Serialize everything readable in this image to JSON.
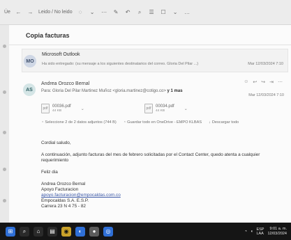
{
  "toolbar": {
    "left_items": [
      "Úe",
      "←",
      "→",
      "Leido / No leido",
      "◌",
      "⌄",
      "⋯",
      "✎",
      "↶",
      "⌕",
      "☰",
      "☐",
      "⌄",
      "…"
    ],
    "colors": {
      "bg": "#ececec"
    }
  },
  "mail": {
    "subject": "Copia facturas",
    "message1": {
      "avatar": "MO",
      "sender": "Microsoft Outlook",
      "preview": "Ha sido entregado: (su mensaje a los siguientes destinatarios del correo. Gloria Del Pilar ...)",
      "date": "Mar 12/03/2024 7:10"
    },
    "message2": {
      "avatar": "AS",
      "sender": "Andrea Orozco Bernal",
      "to_prefix": "Para:",
      "to_name": "Gloria Del Pilar Martinez Muñoz <gloria.martinez@cotigo.co>",
      "to_suffix": "y 1 mas",
      "date": "Mar 12/03/2024 7:10",
      "tools": [
        "☺",
        "↩",
        "↪",
        "⇥",
        "⋯"
      ],
      "attachments": [
        {
          "name": "00036.pdf",
          "size": "44 KB"
        },
        {
          "name": "00034.pdf",
          "size": "44 KB"
        }
      ],
      "attachment_actions": [
        "Seleccione 2 de 2 datos adjuntos (744 B)",
        "Guardar todo en OneDrive - EMPO KLBAS",
        "Descargar todo"
      ],
      "body": [
        "Cordial saludo,",
        "A continuación, adjunto facturas del mes de febrero solicitadas por el Contact  Center, quedo atenta a cualquier requerimiento",
        "Feliz dia",
        "Andrea Orozco Bernal",
        "Apoyo Facturacion",
        "apoyo.facturacion@empocaldas.com.co",
        "Empocaldas S.A. E.S.P.",
        "Carrera 23 N 4 75 - 82"
      ]
    }
  },
  "taskbar": {
    "apps": [
      "⊞",
      "⌕",
      "⌂",
      "▤",
      "◉",
      "◐",
      "●",
      "◎"
    ],
    "right": {
      "lang": "ESP",
      "region": "LAA",
      "time": "9:01 a. m.",
      "date": "12/03/2024"
    }
  }
}
